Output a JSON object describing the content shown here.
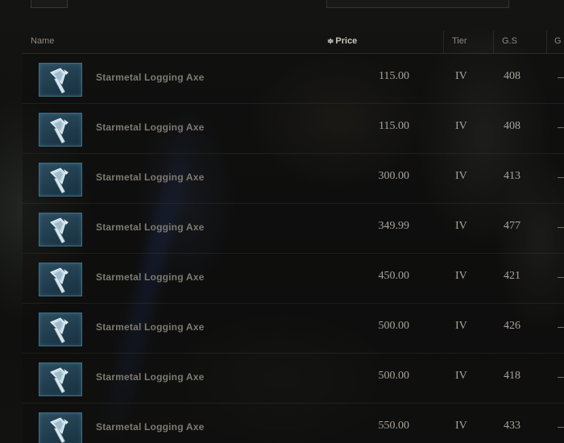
{
  "table": {
    "columns": {
      "name": "Name",
      "price": "Price",
      "tier": "Tier",
      "gear_score": "G.S",
      "extra": "G"
    },
    "sort": {
      "column": "price",
      "direction": "ascending",
      "indicator": "≑"
    },
    "rows": [
      {
        "name": "Starmetal Logging Axe",
        "price": "115.00",
        "tier": "IV",
        "gear_score": "408",
        "extra": "–",
        "icon": "axe-icon"
      },
      {
        "name": "Starmetal Logging Axe",
        "price": "115.00",
        "tier": "IV",
        "gear_score": "408",
        "extra": "–",
        "icon": "axe-icon"
      },
      {
        "name": "Starmetal Logging Axe",
        "price": "300.00",
        "tier": "IV",
        "gear_score": "413",
        "extra": "–",
        "icon": "axe-icon"
      },
      {
        "name": "Starmetal Logging Axe",
        "price": "349.99",
        "tier": "IV",
        "gear_score": "477",
        "extra": "–",
        "icon": "axe-icon"
      },
      {
        "name": "Starmetal Logging Axe",
        "price": "450.00",
        "tier": "IV",
        "gear_score": "421",
        "extra": "–",
        "icon": "axe-icon"
      },
      {
        "name": "Starmetal Logging Axe",
        "price": "500.00",
        "tier": "IV",
        "gear_score": "426",
        "extra": "–",
        "icon": "axe-icon"
      },
      {
        "name": "Starmetal Logging Axe",
        "price": "500.00",
        "tier": "IV",
        "gear_score": "418",
        "extra": "–",
        "icon": "axe-icon"
      },
      {
        "name": "Starmetal Logging Axe",
        "price": "550.00",
        "tier": "IV",
        "gear_score": "433",
        "extra": "–",
        "icon": "axe-icon"
      }
    ]
  },
  "colors": {
    "icon_frame": "#3f6f86",
    "text_primary": "#a8a498",
    "text_secondary": "#7d7a70",
    "header_active": "#c9c4b6"
  }
}
